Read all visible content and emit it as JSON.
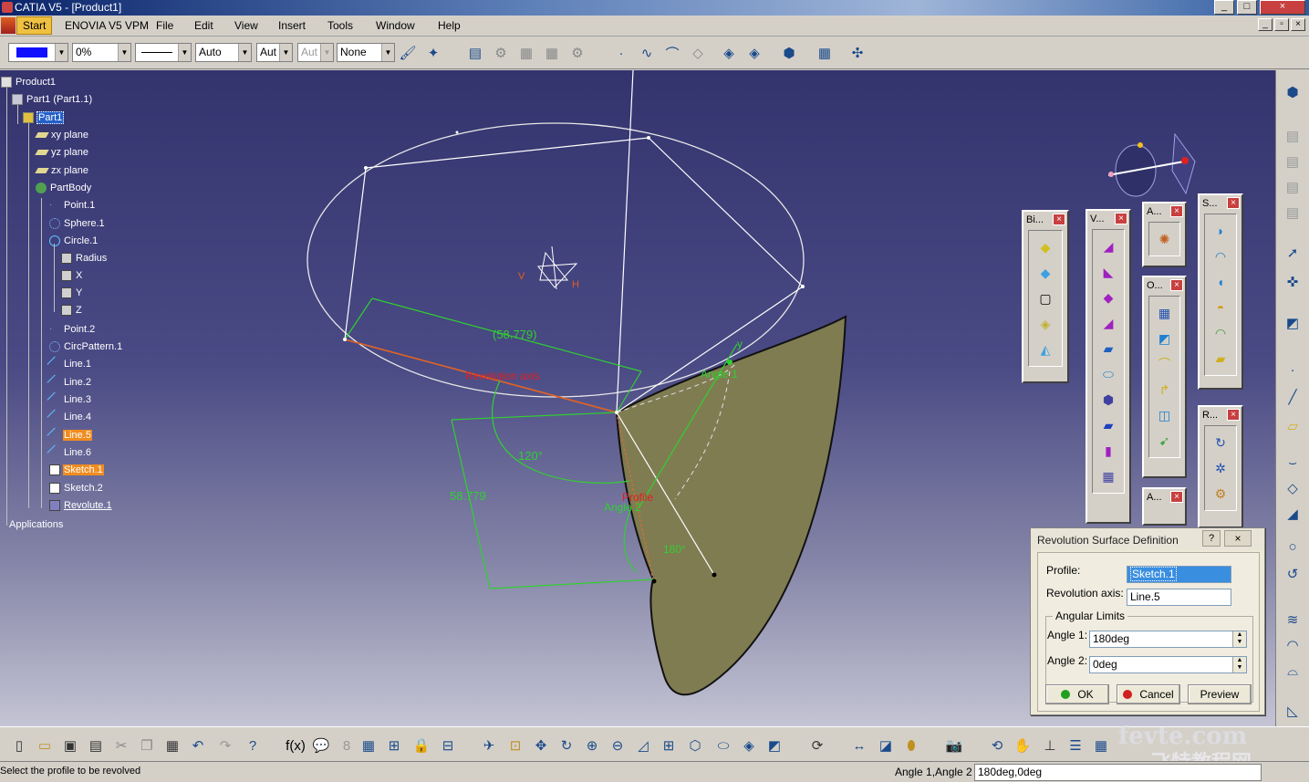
{
  "window": {
    "title": "CATIA V5 - [Product1]",
    "controls": [
      "_",
      "□",
      "×"
    ]
  },
  "menubar": {
    "items": [
      "Start",
      "ENOVIA V5 VPM",
      "File",
      "Edit",
      "View",
      "Insert",
      "Tools",
      "Window",
      "Help"
    ]
  },
  "toolbar": {
    "color": "#1010ff",
    "transparency": "0%",
    "line_thickness": "Auto",
    "line_type": "Aut",
    "point_type": "Aut",
    "layer": "None"
  },
  "tree": {
    "product": "Product1",
    "part_instance": "Part1 (Part1.1)",
    "part": "Part1",
    "planes": [
      "xy plane",
      "yz plane",
      "zx plane"
    ],
    "body": "PartBody",
    "body_items": [
      "Point.1",
      "Sphere.1",
      "Circle.1"
    ],
    "circle_children": [
      "Radius",
      "X",
      "Y",
      "Z"
    ],
    "more_items": [
      "Point.2",
      "CircPattern.1",
      "Line.1",
      "Line.2",
      "Line.3",
      "Line.4",
      "Line.5",
      "Line.6",
      "Sketch.1",
      "Sketch.2",
      "Revolute.1"
    ],
    "applications": "Applications"
  },
  "viewport": {
    "dim_upper": "(58.779)",
    "dim_lower": "58.779",
    "angle_label_1": "120°",
    "angle_label_2": "180°",
    "axis_label": "Revolution axis",
    "profile_label": "Profile",
    "angle_handle_1": "Angle 1",
    "angle_handle_2": "Angle 2",
    "axis_v": "V",
    "axis_h": "H",
    "axis_y": "y"
  },
  "floatbars": {
    "bi": "Bi...",
    "v": "V...",
    "a1": "A...",
    "s": "S...",
    "o": "O...",
    "r": "R...",
    "a2": "A..."
  },
  "dialog": {
    "title": "Revolution Surface Definition",
    "help": "?",
    "close": "×",
    "profile_label": "Profile:",
    "profile_value": "Sketch.1",
    "axis_label": "Revolution axis:",
    "axis_value": "Line.5",
    "group_title": "Angular Limits",
    "angle1_label": "Angle 1:",
    "angle1_value": "180deg",
    "angle2_label": "Angle 2:",
    "angle2_value": "0deg",
    "ok": "OK",
    "cancel": "Cancel",
    "preview": "Preview"
  },
  "status": {
    "message": "Select the profile to be revolved",
    "prompt": "Angle 1,Angle 2",
    "value": "180deg,0deg"
  },
  "watermark": {
    "line1": "fevte.com",
    "line2": "飞特教程网"
  },
  "colors": {
    "surface": "#807c52",
    "sketch_green": "#30d030",
    "axis_orange": "#e06020",
    "wire_white": "#ffffff"
  }
}
